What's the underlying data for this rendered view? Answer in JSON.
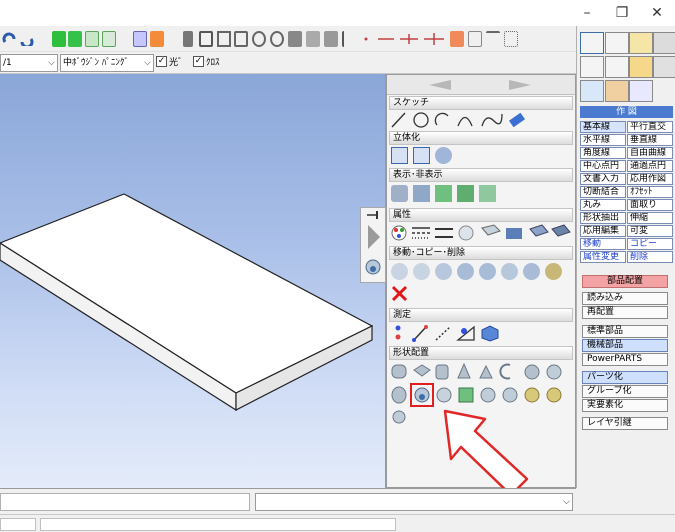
{
  "window": {
    "minimize_label": "–",
    "restore_label": "❐",
    "close_label": "✕"
  },
  "toolbar2": {
    "layer_value": "/1",
    "linetype_value": "中ﾎﾞｳｼﾞﾝ ﾊﾟﾆﾝｸﾞ",
    "check1_label": "光゛",
    "check2_label": "ｸﾛｽ"
  },
  "palette": {
    "sections": {
      "sketch": "スケッチ",
      "solid": "立体化",
      "visibility": "表示･非表示",
      "attribute": "属性",
      "move": "移動･コピー･削除",
      "measure": "測定",
      "shape": "形状配置"
    }
  },
  "commands": {
    "header": "作 図",
    "rows": [
      [
        "基本線",
        "平行直交"
      ],
      [
        "水平線",
        "垂直線"
      ],
      [
        "角度線",
        "自由曲線"
      ],
      [
        "中心点円",
        "通過点円"
      ],
      [
        "文書入力",
        "応用作図"
      ],
      [
        "切断結合",
        "ｵﾌｾｯﾄ"
      ],
      [
        "丸み",
        "面取り"
      ],
      [
        "形状抽出",
        "伸縮"
      ],
      [
        "応用編集",
        "可変"
      ],
      [
        "移動",
        "コピー"
      ],
      [
        "属性変更",
        "削除"
      ]
    ],
    "parts_header": "部品配置",
    "buttons": [
      "読み込み",
      "再配置",
      "標準部品",
      "機械部品",
      "PowerPARTS",
      "パーツ化",
      "グループ化",
      "実要素化",
      "レイヤ引継"
    ]
  },
  "colors": {
    "accent": "#4a7bd0",
    "highlight_red": "#e03030",
    "parts_header_bg": "#f3a3a3"
  }
}
